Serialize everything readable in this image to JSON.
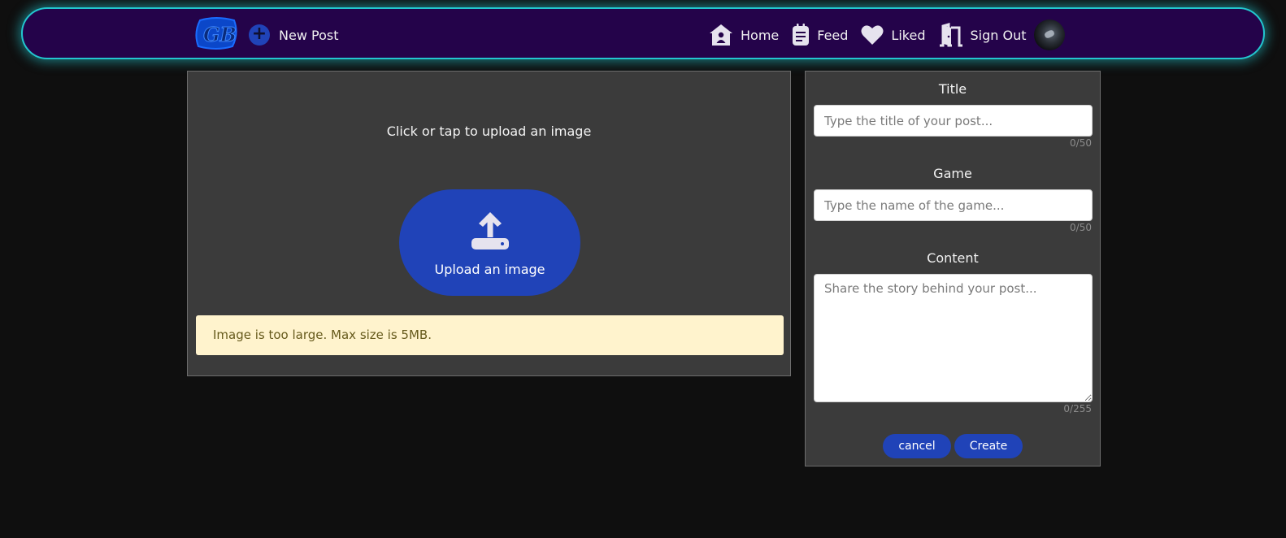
{
  "colors": {
    "navbar_bg": "#24034a",
    "navbar_glow": "#23c6cf",
    "accent": "#2043b8",
    "panel_bg": "#3b3b3b",
    "page_bg": "#0f0f0f",
    "alert_bg": "#fff3cd",
    "alert_text": "#665a1c"
  },
  "navbar": {
    "logo_icon": "gb-logo",
    "new_post": {
      "icon": "plus-circle-icon",
      "label": "New Post"
    },
    "links": [
      {
        "icon": "home-icon",
        "label": "Home"
      },
      {
        "icon": "feed-icon",
        "label": "Feed"
      },
      {
        "icon": "heart-icon",
        "label": "Liked"
      },
      {
        "icon": "door-icon",
        "label": "Sign Out"
      }
    ],
    "avatar": "user-avatar"
  },
  "upload": {
    "hint": "Click or tap to upload an image",
    "button_icon": "upload-icon",
    "button_label": "Upload an image",
    "alert": "Image is too large. Max size is 5MB."
  },
  "form": {
    "title": {
      "label": "Title",
      "placeholder": "Type the title of your post...",
      "value": "",
      "counter": "0/50"
    },
    "game": {
      "label": "Game",
      "placeholder": "Type the name of the game...",
      "value": "",
      "counter": "0/50"
    },
    "content": {
      "label": "Content",
      "placeholder": "Share the story behind your post...",
      "value": "",
      "counter": "0/255"
    },
    "cancel_label": "cancel",
    "create_label": "Create"
  }
}
